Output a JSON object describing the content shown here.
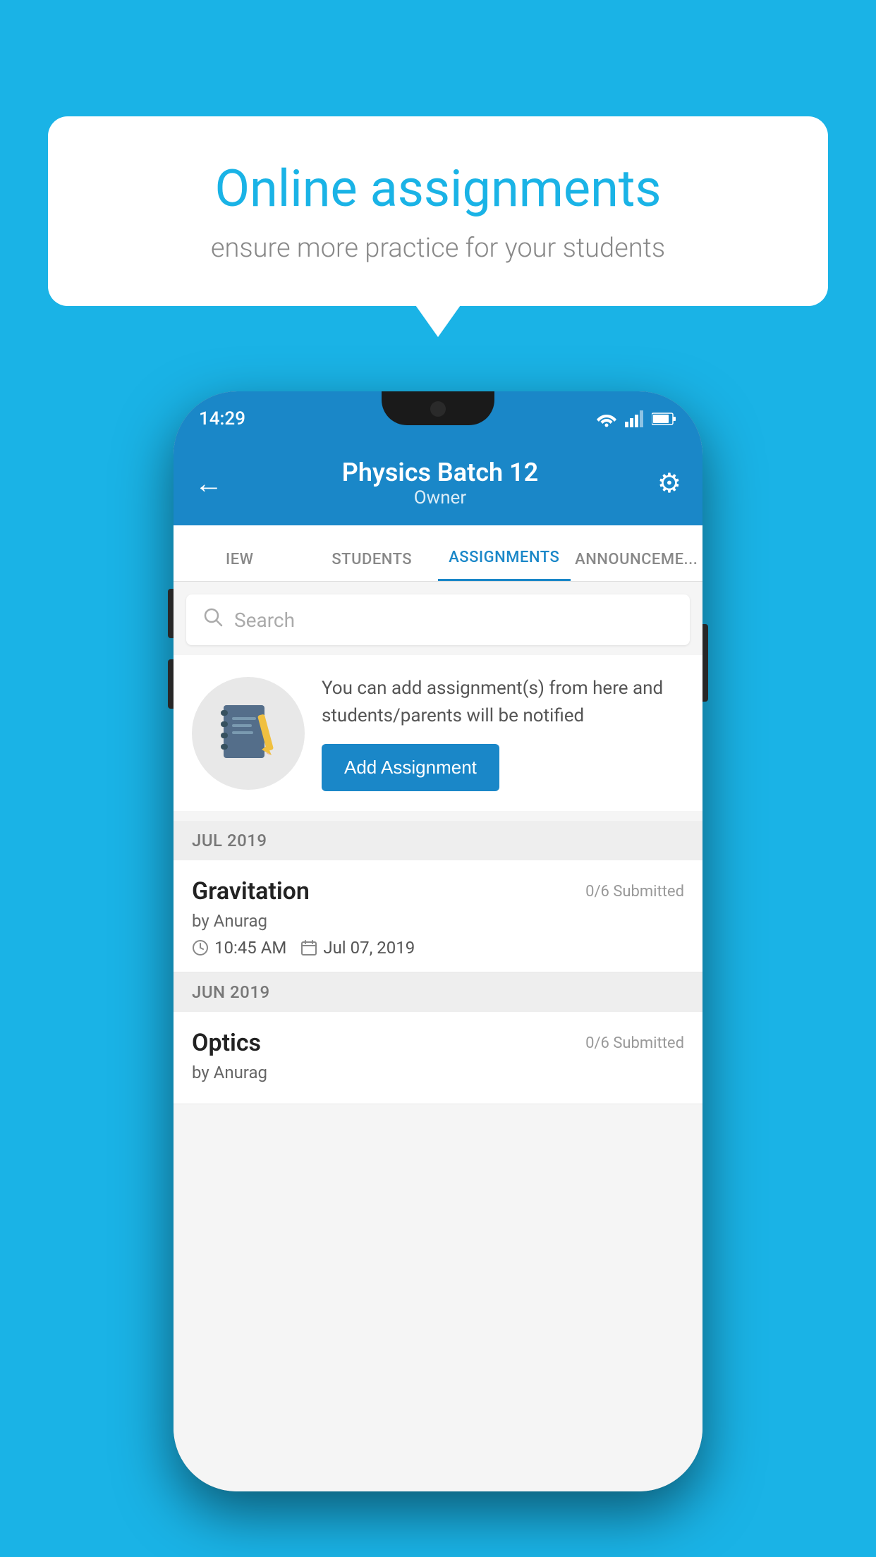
{
  "background_color": "#1ab3e6",
  "speech_bubble": {
    "title": "Online assignments",
    "subtitle": "ensure more practice for your students"
  },
  "status_bar": {
    "time": "14:29",
    "wifi": "▾",
    "signal": "▴",
    "battery": "▮"
  },
  "app_bar": {
    "title": "Physics Batch 12",
    "subtitle": "Owner",
    "back_label": "←",
    "settings_label": "⚙"
  },
  "tabs": [
    {
      "label": "IEW",
      "active": false
    },
    {
      "label": "STUDENTS",
      "active": false
    },
    {
      "label": "ASSIGNMENTS",
      "active": true
    },
    {
      "label": "ANNOUNCEMENTS",
      "active": false
    }
  ],
  "search": {
    "placeholder": "Search"
  },
  "promo_card": {
    "description": "You can add assignment(s) from here and students/parents will be notified",
    "button_label": "Add Assignment"
  },
  "sections": [
    {
      "label": "JUL 2019",
      "assignments": [
        {
          "name": "Gravitation",
          "submitted": "0/6 Submitted",
          "by": "by Anurag",
          "time": "10:45 AM",
          "date": "Jul 07, 2019"
        }
      ]
    },
    {
      "label": "JUN 2019",
      "assignments": [
        {
          "name": "Optics",
          "submitted": "0/6 Submitted",
          "by": "by Anurag",
          "time": "",
          "date": ""
        }
      ]
    }
  ]
}
